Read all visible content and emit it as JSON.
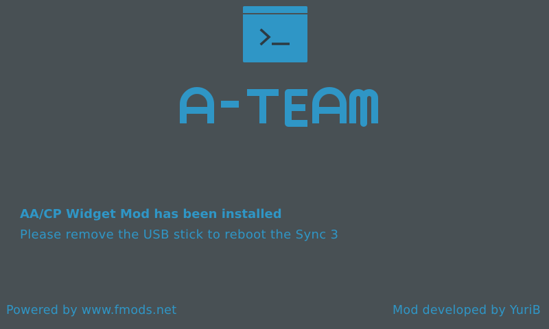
{
  "branding": {
    "logo_icon": "terminal-prompt-icon",
    "name": "A-TEAM"
  },
  "message": {
    "title": "AA/CP Widget Mod has been installed",
    "instruction": "Please remove the USB stick to reboot the Sync 3"
  },
  "footer": {
    "powered_by": "Powered by www.fmods.net",
    "developer": "Mod developed by YuriB"
  },
  "colors": {
    "background": "#485054",
    "accent": "#2f96c6",
    "icon_glyph": "#2d3a42"
  }
}
